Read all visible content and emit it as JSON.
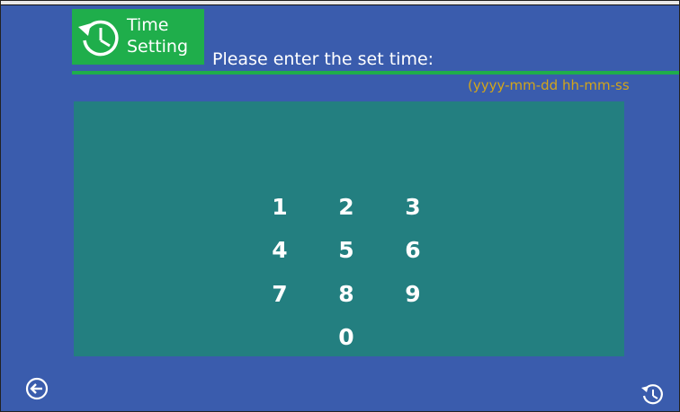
{
  "header": {
    "title_line1": "Time",
    "title_line2": "Setting",
    "prompt": "Please enter the set time:",
    "format_hint": "(yyyy-mm-dd  hh-mm-ss"
  },
  "keypad": {
    "keys": [
      "1",
      "2",
      "3",
      "4",
      "5",
      "6",
      "7",
      "8",
      "9",
      "0"
    ]
  },
  "icons": {
    "title": "clock-history-icon",
    "back": "back-arrow-circle-icon",
    "reset": "history-clock-icon"
  },
  "colors": {
    "background": "#3a5cad",
    "accent_green": "#1fae4b",
    "panel": "#237f80",
    "format_text": "#d3a51a"
  }
}
